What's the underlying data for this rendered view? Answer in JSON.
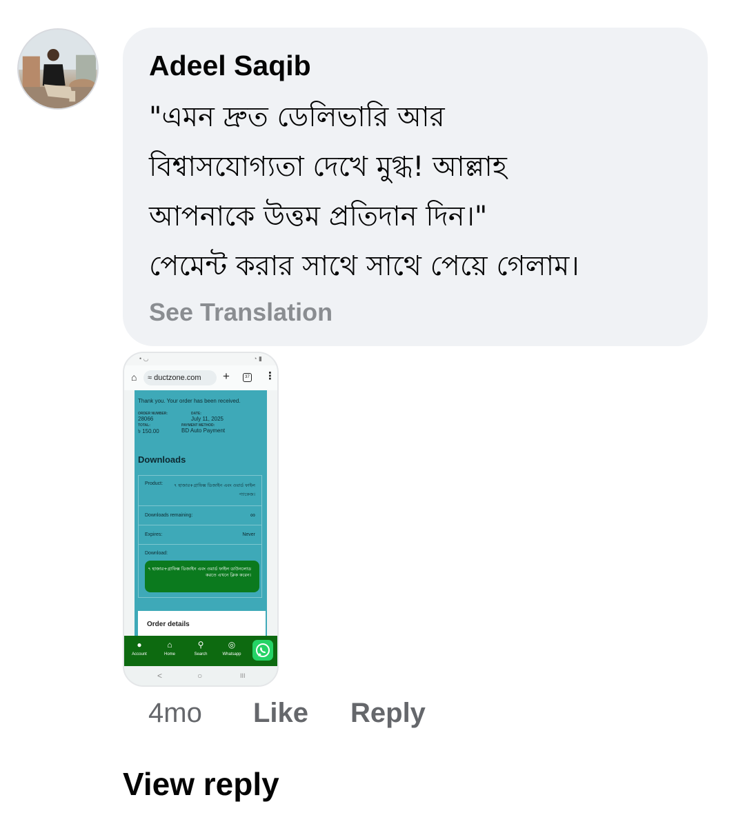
{
  "comment": {
    "author": "Adeel Saqib",
    "text_lines": [
      "\"এমন দ্রুত ডেলিভারি আর",
      "বিশ্বাসযোগ্যতা দেখে মুগ্ধ! আল্লাহ",
      "আপনাকে উত্তম প্রতিদান দিন।\"",
      "পেমেন্ট করার সাথে সাথে পেয়ে গেলাম।"
    ],
    "see_translation": "See Translation",
    "time": "4mo",
    "like_label": "Like",
    "reply_label": "Reply",
    "view_reply_label": "View reply"
  },
  "attachment": {
    "browser": {
      "url": "≈ ductzone.com",
      "plus": "+",
      "tab_count": "37",
      "menu": "⋮",
      "home": "⌂"
    },
    "order": {
      "thanks": "Thank you. Your order has been received.",
      "order_number_label": "ORDER NUMBER:",
      "order_number": "28066",
      "date_label": "DATE:",
      "date": "July 11, 2025",
      "total_label": "TOTAL:",
      "total": "৳ 150.00",
      "payment_method_label": "PAYMENT METHOD:",
      "payment_method": "BD Auto Payment"
    },
    "downloads": {
      "heading": "Downloads",
      "product_label": "Product:",
      "product_value": "৭ হাজার+গ্রাফিক্স ডিজাইন এবং ওয়ার্ড ফাইল প্যাকেজ।",
      "remaining_label": "Downloads remaining:",
      "remaining_value": "∞",
      "expires_label": "Expires:",
      "expires_value": "Never",
      "download_label": "Download:",
      "download_button": "৭ হাজার+গ্রাফিক্স ডিজাইন এবং ওয়ার্ড ফাইল ডাউনলোড করতে এখনে ক্লিক করেন।"
    },
    "order_details": "Order details",
    "bottom_nav": [
      {
        "icon": "user-icon",
        "glyph": "●",
        "label": "Account"
      },
      {
        "icon": "home-icon",
        "glyph": "⌂",
        "label": "Home"
      },
      {
        "icon": "search-icon",
        "glyph": "⚲",
        "label": "Search"
      },
      {
        "icon": "whatsapp-icon",
        "glyph": "◎",
        "label": "Whatsapp"
      }
    ],
    "system_nav": {
      "back": "<",
      "home": "○",
      "recents": "III"
    }
  },
  "colors": {
    "bubble": "#f0f2f5",
    "muted_text": "#65676b",
    "teal": "#3ea9b8",
    "green_nav": "#0d6a10",
    "whatsapp": "#25d366"
  }
}
